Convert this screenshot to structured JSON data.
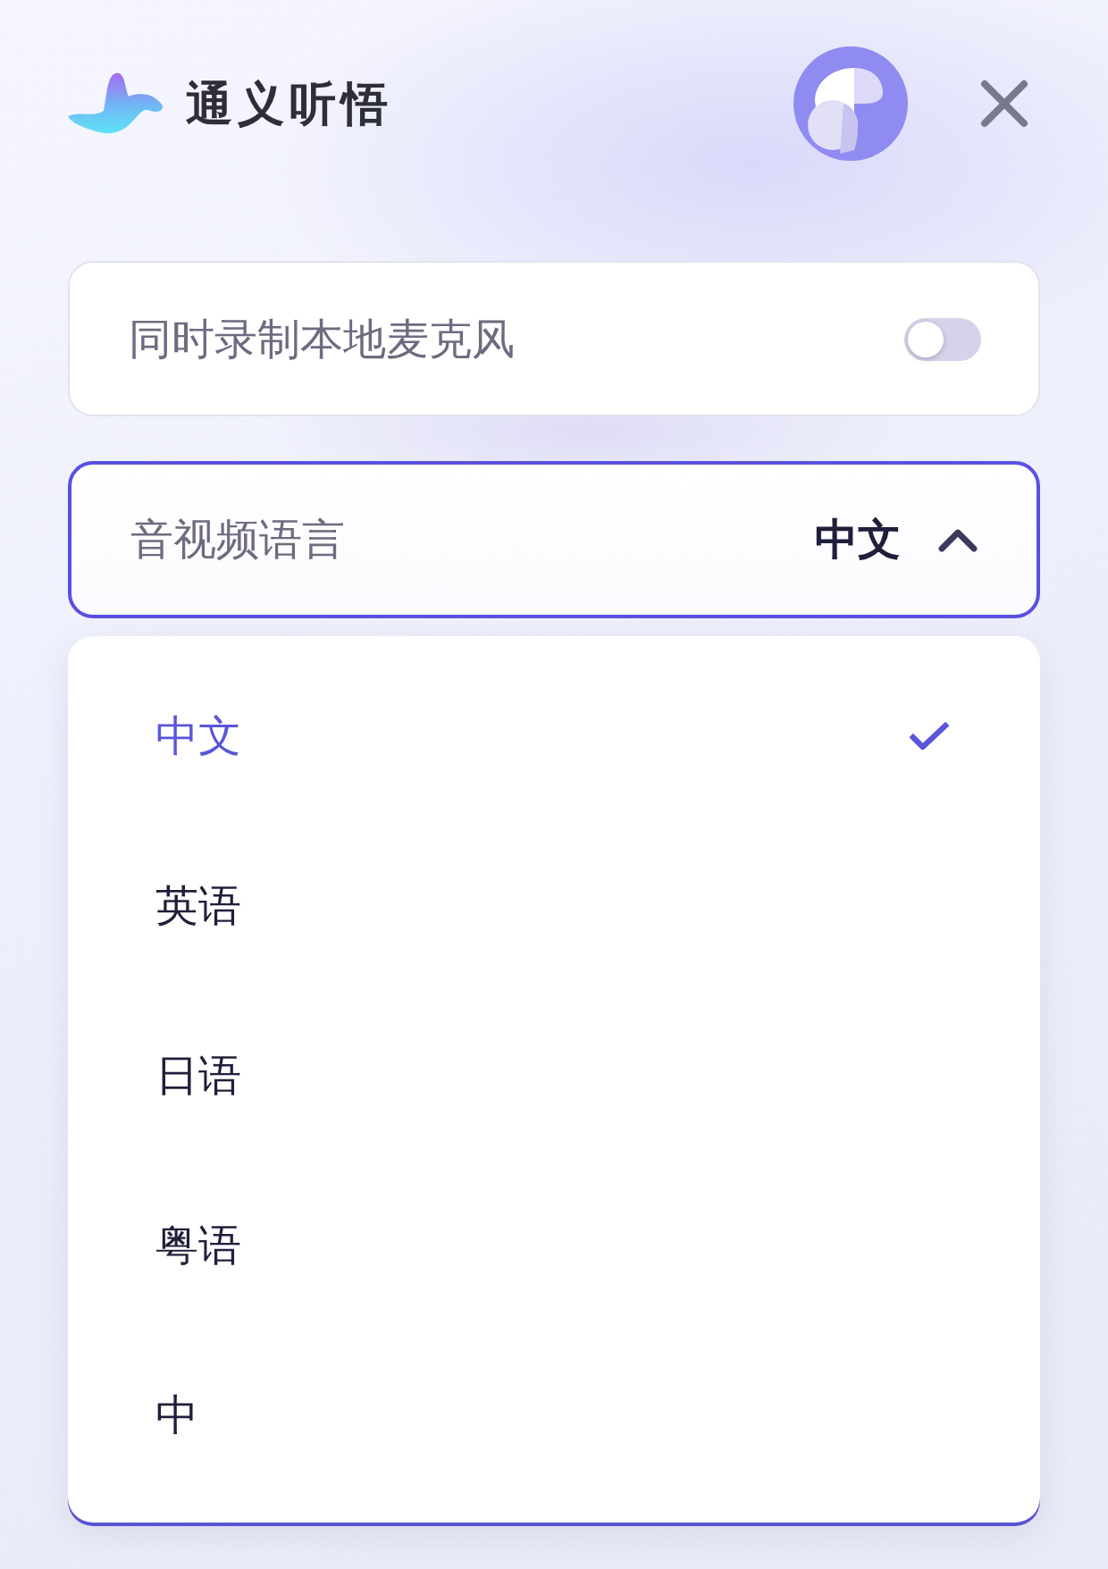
{
  "header": {
    "title": "通义听悟"
  },
  "microphone": {
    "label": "同时录制本地麦克风",
    "on": false
  },
  "language": {
    "label": "音视频语言",
    "value": "中文",
    "expanded": true,
    "options": [
      {
        "label": "中文",
        "selected": true
      },
      {
        "label": "英语",
        "selected": false
      },
      {
        "label": "日语",
        "selected": false
      },
      {
        "label": "粤语",
        "selected": false
      },
      {
        "label": "中",
        "selected": false
      }
    ]
  }
}
